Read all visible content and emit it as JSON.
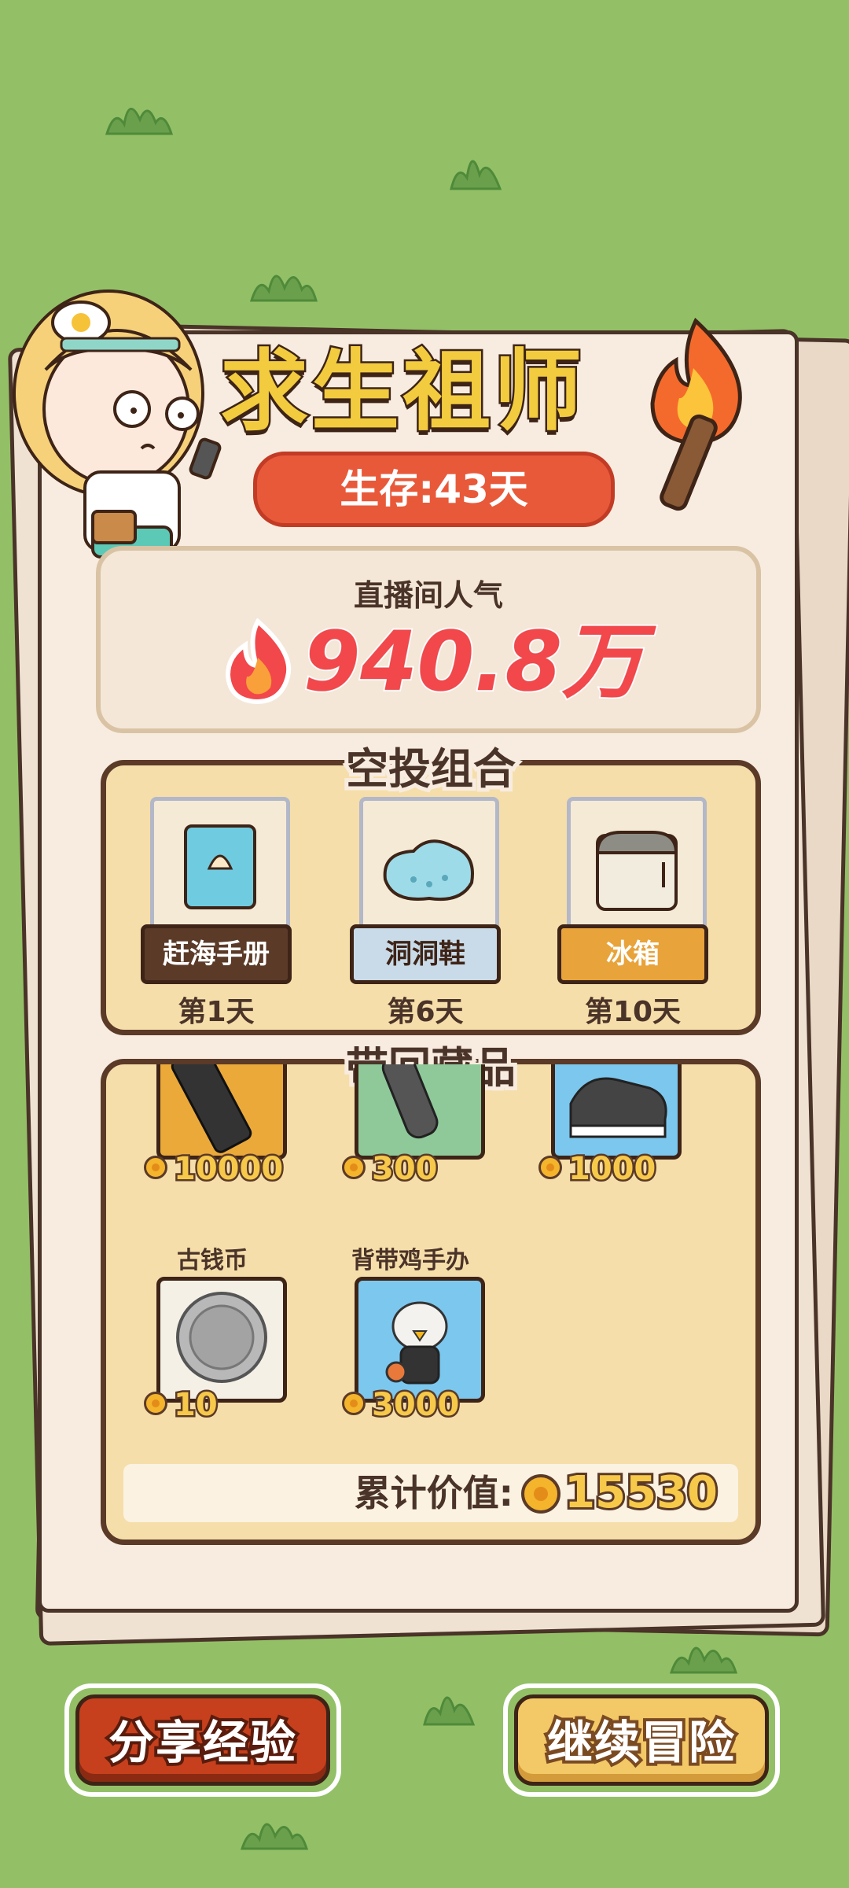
{
  "title": "求生祖师",
  "survival": "生存:43天",
  "popularity": {
    "label": "直播间人气",
    "value": "940.8万"
  },
  "airdrop": {
    "title": "空投组合",
    "items": [
      {
        "name": "赶海手册",
        "day": "第1天",
        "icon": "book-icon",
        "tag_color": "#5b3a28"
      },
      {
        "name": "洞洞鞋",
        "day": "第6天",
        "icon": "clog-icon",
        "tag_color": "#c9dbe8"
      },
      {
        "name": "冰箱",
        "day": "第10天",
        "icon": "fridge-icon",
        "tag_color": "#e8a33a"
      }
    ]
  },
  "collection": {
    "title": "带回藏品",
    "items": [
      {
        "name": "",
        "price": "10000",
        "icon": "phone-icon"
      },
      {
        "name": "",
        "price": "300",
        "icon": "remote-icon"
      },
      {
        "name": "",
        "price": "1000",
        "icon": "sneaker-icon"
      },
      {
        "name": "古钱币",
        "price": "10",
        "icon": "ancient-coin-icon"
      },
      {
        "name": "背带鸡手办",
        "price": "3000",
        "icon": "chicken-figure-icon"
      }
    ],
    "total_label": "累计价值:",
    "total_value": "15530"
  },
  "buttons": {
    "share": "分享经验",
    "continue": "继续冒险"
  }
}
